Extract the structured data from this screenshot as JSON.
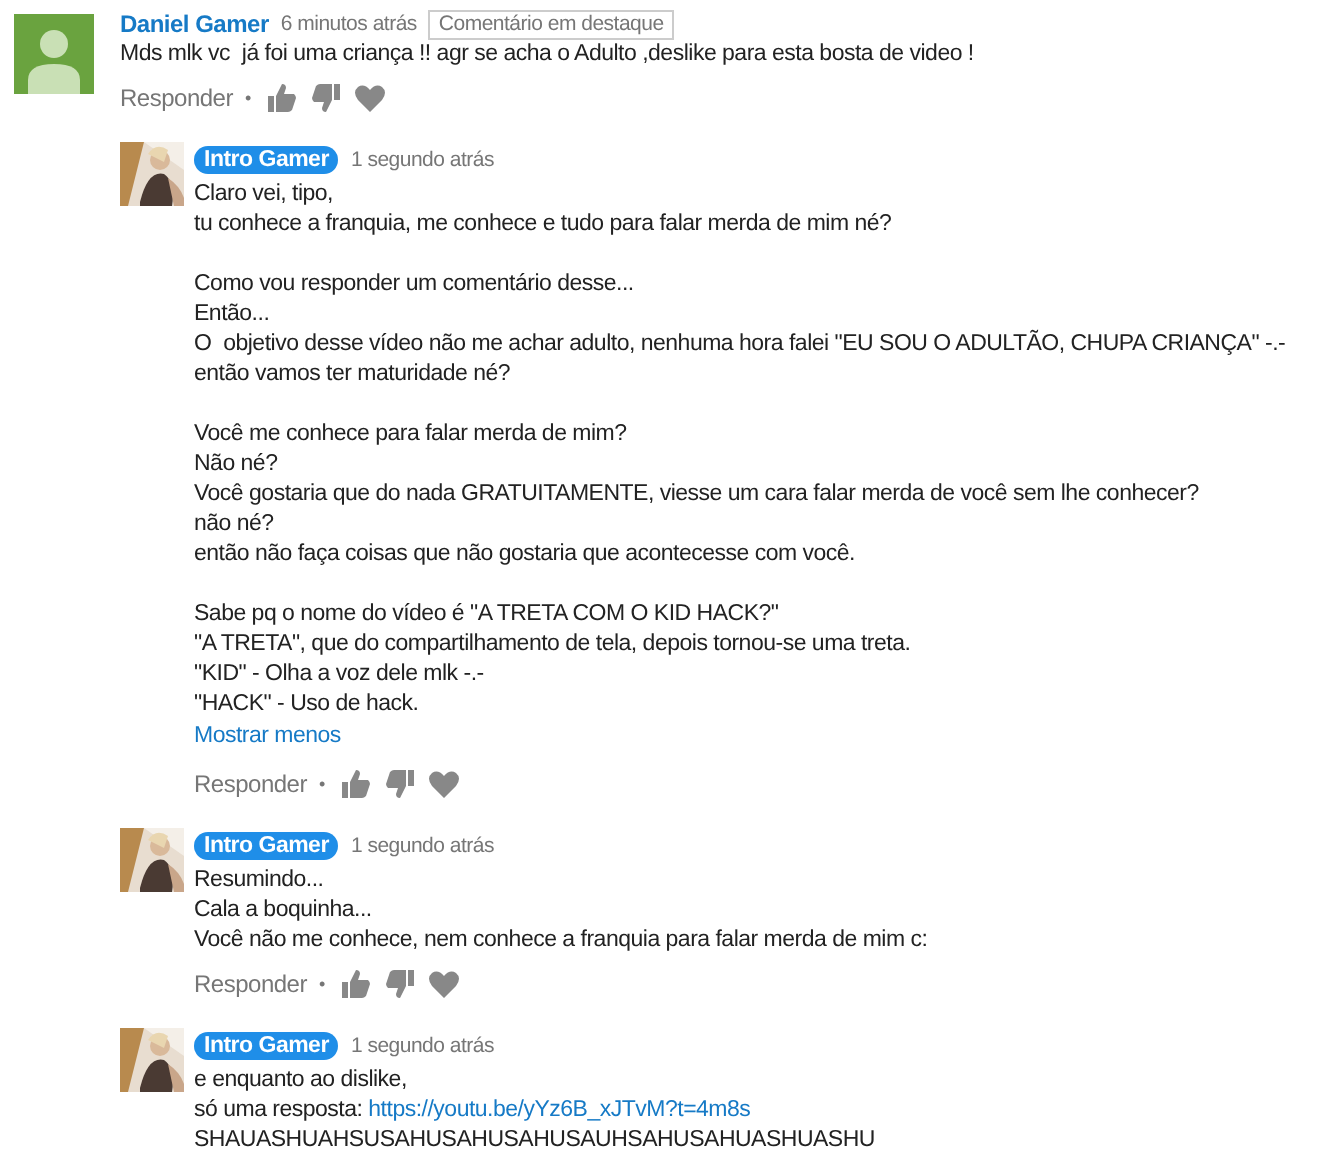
{
  "comments": [
    {
      "author": "Daniel Gamer",
      "owner": false,
      "avatar": {
        "kind": "default"
      },
      "time": "6 minutos atrás",
      "badge": "Comentário em destaque",
      "paragraphs": [
        [
          "Mds mlk vc  já foi uma criança !! agr se acha o Adulto ,deslike para esta bosta de video !"
        ]
      ],
      "actions": {
        "reply": "Responder",
        "separator": "•"
      },
      "children": [
        {
          "author": "Intro Gamer",
          "owner": true,
          "avatar": {
            "kind": "picture"
          },
          "time": "1 segundo atrás",
          "paragraphs": [
            [
              "Claro vei, tipo,",
              "tu conhece a franquia, me conhece e tudo para falar merda de mim né?"
            ],
            [
              "Como vou responder um comentário desse...",
              "Então...",
              "O  objetivo desse vídeo não me achar adulto, nenhuma hora falei \"EU SOU O ADULTÃO, CHUPA CRIANÇA\" -.-",
              "então vamos ter maturidade né?"
            ],
            [
              "Você me conhece para falar merda de mim?",
              "Não né?",
              "Você gostaria que do nada GRATUITAMENTE, viesse um cara falar merda de você sem lhe conhecer?",
              "não né?",
              "então não faça coisas que não gostaria que acontecesse com você."
            ],
            [
              "Sabe pq o nome do vídeo é \"A TRETA COM O KID HACK?\"",
              "\"A TRETA\", que do compartilhamento de tela, depois tornou-se uma treta.",
              "\"KID\" - Olha a voz dele mlk -.-",
              "\"HACK\" - Uso de hack."
            ]
          ],
          "toggle": "Mostrar menos",
          "actions": {
            "reply": "Responder",
            "separator": "•"
          }
        },
        {
          "author": "Intro Gamer",
          "owner": true,
          "avatar": {
            "kind": "picture"
          },
          "time": "1 segundo atrás",
          "paragraphs": [
            [
              "Resumindo...",
              "Cala a boquinha...",
              "Você não me conhece, nem conhece a franquia para falar merda de mim c:"
            ]
          ],
          "actions": {
            "reply": "Responder",
            "separator": "•"
          }
        },
        {
          "author": "Intro Gamer",
          "owner": true,
          "avatar": {
            "kind": "picture"
          },
          "time": "1 segundo atrás",
          "paragraphs": [
            [
              "e enquanto ao dislike,",
              {
                "text": "só uma resposta: ",
                "link": "https://youtu.be/yYz6B_xJTvM?t=4m8s"
              },
              "SHAUASHUAHSUSAHUSAHUSAHUSAUHSAHUSAHUASHUASHU"
            ]
          ]
        }
      ]
    }
  ]
}
